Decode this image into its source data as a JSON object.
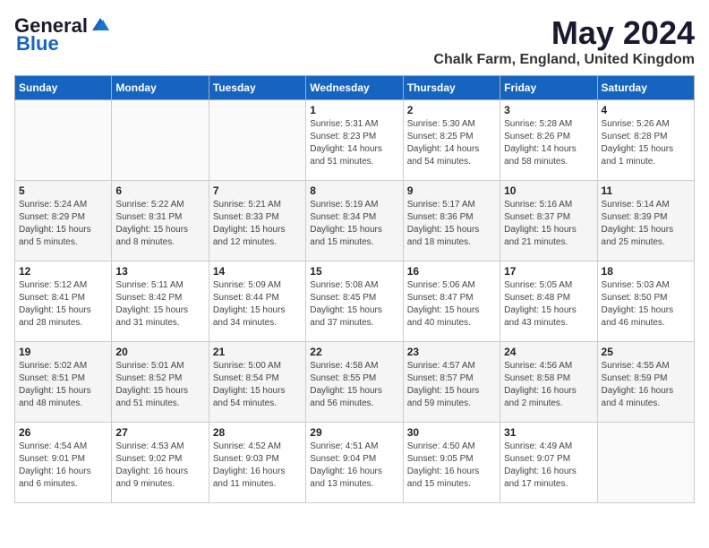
{
  "header": {
    "logo_general": "General",
    "logo_blue": "Blue",
    "month_year": "May 2024",
    "location": "Chalk Farm, England, United Kingdom"
  },
  "days_of_week": [
    "Sunday",
    "Monday",
    "Tuesday",
    "Wednesday",
    "Thursday",
    "Friday",
    "Saturday"
  ],
  "weeks": [
    [
      {
        "day": "",
        "info": ""
      },
      {
        "day": "",
        "info": ""
      },
      {
        "day": "",
        "info": ""
      },
      {
        "day": "1",
        "info": "Sunrise: 5:31 AM\nSunset: 8:23 PM\nDaylight: 14 hours and 51 minutes."
      },
      {
        "day": "2",
        "info": "Sunrise: 5:30 AM\nSunset: 8:25 PM\nDaylight: 14 hours and 54 minutes."
      },
      {
        "day": "3",
        "info": "Sunrise: 5:28 AM\nSunset: 8:26 PM\nDaylight: 14 hours and 58 minutes."
      },
      {
        "day": "4",
        "info": "Sunrise: 5:26 AM\nSunset: 8:28 PM\nDaylight: 15 hours and 1 minute."
      }
    ],
    [
      {
        "day": "5",
        "info": "Sunrise: 5:24 AM\nSunset: 8:29 PM\nDaylight: 15 hours and 5 minutes."
      },
      {
        "day": "6",
        "info": "Sunrise: 5:22 AM\nSunset: 8:31 PM\nDaylight: 15 hours and 8 minutes."
      },
      {
        "day": "7",
        "info": "Sunrise: 5:21 AM\nSunset: 8:33 PM\nDaylight: 15 hours and 12 minutes."
      },
      {
        "day": "8",
        "info": "Sunrise: 5:19 AM\nSunset: 8:34 PM\nDaylight: 15 hours and 15 minutes."
      },
      {
        "day": "9",
        "info": "Sunrise: 5:17 AM\nSunset: 8:36 PM\nDaylight: 15 hours and 18 minutes."
      },
      {
        "day": "10",
        "info": "Sunrise: 5:16 AM\nSunset: 8:37 PM\nDaylight: 15 hours and 21 minutes."
      },
      {
        "day": "11",
        "info": "Sunrise: 5:14 AM\nSunset: 8:39 PM\nDaylight: 15 hours and 25 minutes."
      }
    ],
    [
      {
        "day": "12",
        "info": "Sunrise: 5:12 AM\nSunset: 8:41 PM\nDaylight: 15 hours and 28 minutes."
      },
      {
        "day": "13",
        "info": "Sunrise: 5:11 AM\nSunset: 8:42 PM\nDaylight: 15 hours and 31 minutes."
      },
      {
        "day": "14",
        "info": "Sunrise: 5:09 AM\nSunset: 8:44 PM\nDaylight: 15 hours and 34 minutes."
      },
      {
        "day": "15",
        "info": "Sunrise: 5:08 AM\nSunset: 8:45 PM\nDaylight: 15 hours and 37 minutes."
      },
      {
        "day": "16",
        "info": "Sunrise: 5:06 AM\nSunset: 8:47 PM\nDaylight: 15 hours and 40 minutes."
      },
      {
        "day": "17",
        "info": "Sunrise: 5:05 AM\nSunset: 8:48 PM\nDaylight: 15 hours and 43 minutes."
      },
      {
        "day": "18",
        "info": "Sunrise: 5:03 AM\nSunset: 8:50 PM\nDaylight: 15 hours and 46 minutes."
      }
    ],
    [
      {
        "day": "19",
        "info": "Sunrise: 5:02 AM\nSunset: 8:51 PM\nDaylight: 15 hours and 48 minutes."
      },
      {
        "day": "20",
        "info": "Sunrise: 5:01 AM\nSunset: 8:52 PM\nDaylight: 15 hours and 51 minutes."
      },
      {
        "day": "21",
        "info": "Sunrise: 5:00 AM\nSunset: 8:54 PM\nDaylight: 15 hours and 54 minutes."
      },
      {
        "day": "22",
        "info": "Sunrise: 4:58 AM\nSunset: 8:55 PM\nDaylight: 15 hours and 56 minutes."
      },
      {
        "day": "23",
        "info": "Sunrise: 4:57 AM\nSunset: 8:57 PM\nDaylight: 15 hours and 59 minutes."
      },
      {
        "day": "24",
        "info": "Sunrise: 4:56 AM\nSunset: 8:58 PM\nDaylight: 16 hours and 2 minutes."
      },
      {
        "day": "25",
        "info": "Sunrise: 4:55 AM\nSunset: 8:59 PM\nDaylight: 16 hours and 4 minutes."
      }
    ],
    [
      {
        "day": "26",
        "info": "Sunrise: 4:54 AM\nSunset: 9:01 PM\nDaylight: 16 hours and 6 minutes."
      },
      {
        "day": "27",
        "info": "Sunrise: 4:53 AM\nSunset: 9:02 PM\nDaylight: 16 hours and 9 minutes."
      },
      {
        "day": "28",
        "info": "Sunrise: 4:52 AM\nSunset: 9:03 PM\nDaylight: 16 hours and 11 minutes."
      },
      {
        "day": "29",
        "info": "Sunrise: 4:51 AM\nSunset: 9:04 PM\nDaylight: 16 hours and 13 minutes."
      },
      {
        "day": "30",
        "info": "Sunrise: 4:50 AM\nSunset: 9:05 PM\nDaylight: 16 hours and 15 minutes."
      },
      {
        "day": "31",
        "info": "Sunrise: 4:49 AM\nSunset: 9:07 PM\nDaylight: 16 hours and 17 minutes."
      },
      {
        "day": "",
        "info": ""
      }
    ]
  ]
}
